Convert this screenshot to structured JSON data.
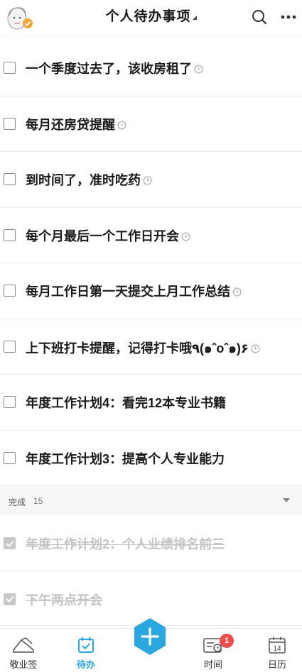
{
  "header": {
    "title": "个人待办事项"
  },
  "todos": [
    {
      "text": "一个季度过去了，该收房租了",
      "has_reminder": true
    },
    {
      "text": "每月还房贷提醒",
      "has_reminder": true
    },
    {
      "text": "到时间了，准时吃药",
      "has_reminder": true
    },
    {
      "text": "每个月最后一个工作日开会",
      "has_reminder": true
    },
    {
      "text": "每月工作日第一天提交上月工作总结",
      "has_reminder": true
    },
    {
      "text": "上下班打卡提醒，记得打卡哦٩(๑ˆoˆ๑)۶",
      "has_reminder": true
    },
    {
      "text": "年度工作计划4：看完12本专业书籍",
      "has_reminder": false
    },
    {
      "text": "年度工作计划3：提高个人专业能力",
      "has_reminder": false
    }
  ],
  "completed": {
    "label": "完成",
    "count": "15",
    "items": [
      {
        "text": "年度工作计划2：个人业绩排名前三"
      },
      {
        "text": "下午两点开会"
      }
    ]
  },
  "tabbar": {
    "tab1": "敬业签",
    "tab2": "待办",
    "tab4": "时间",
    "tab4_badge": "1",
    "tab5": "日历",
    "calendar_day": "14"
  },
  "colors": {
    "accent": "#2aa7de",
    "badge": "#ee4b4b",
    "avatar_badge": "#f2a33a"
  }
}
